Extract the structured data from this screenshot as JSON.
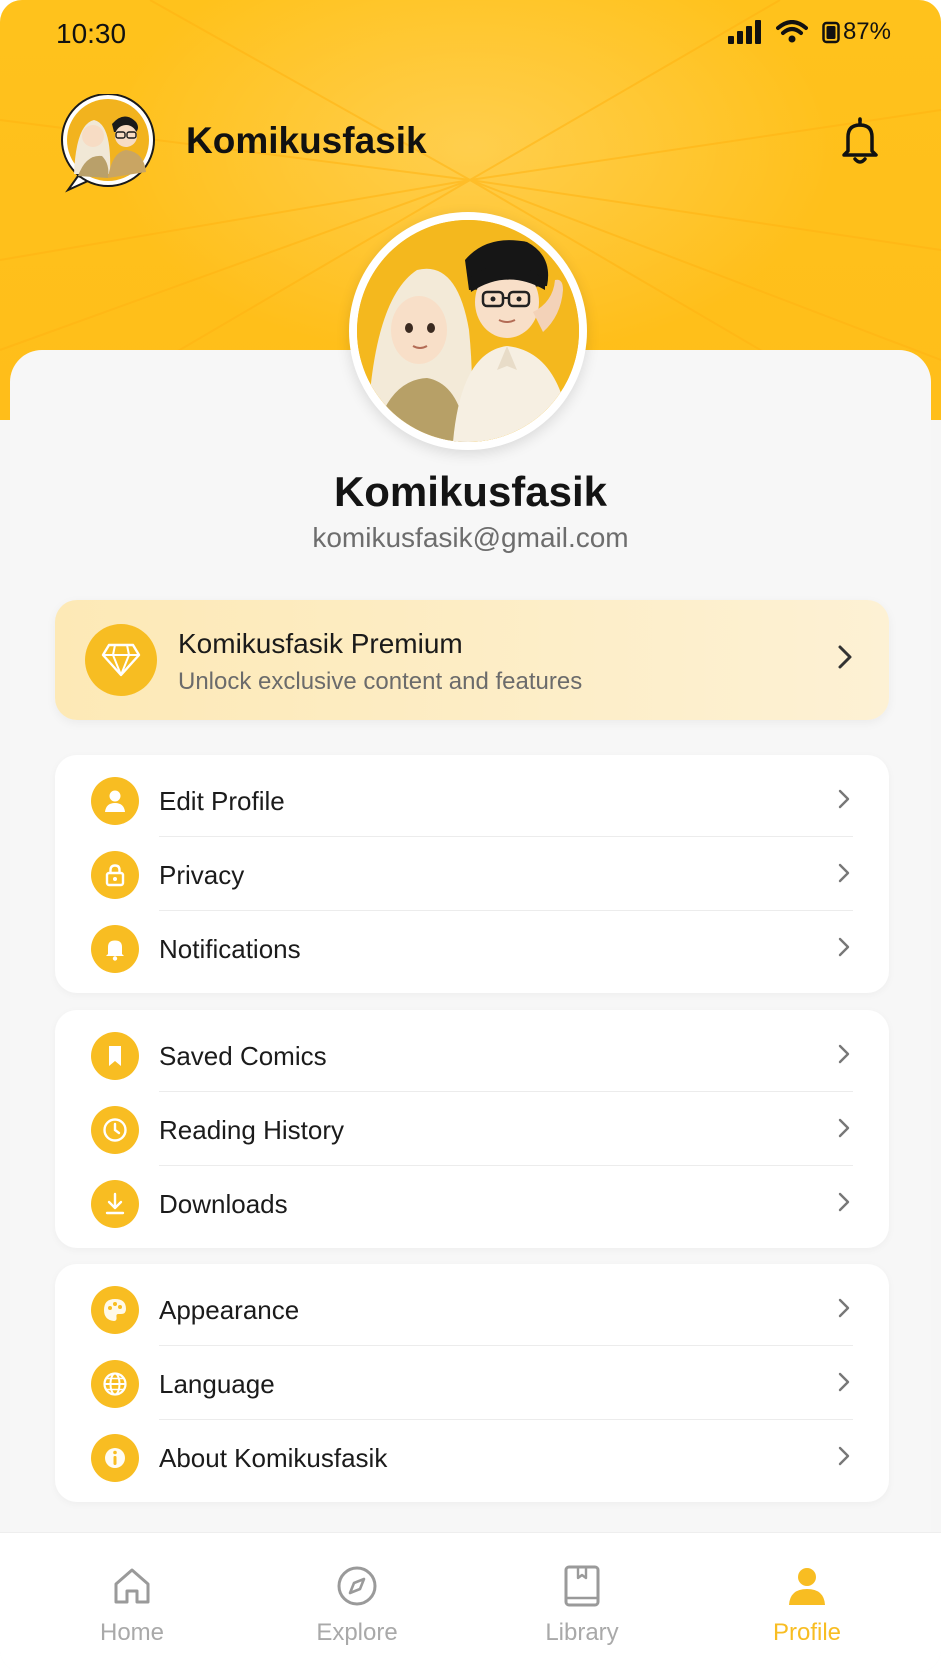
{
  "status_bar": {
    "time": "10:30",
    "battery": "87%"
  },
  "app_bar": {
    "title": "Komikusfasik"
  },
  "profile": {
    "name": "Komikusfasik",
    "email": "komikusfasik@gmail.com"
  },
  "premium": {
    "title": "Komikusfasik Premium",
    "subtitle": "Unlock exclusive content and features"
  },
  "sections": {
    "account": [
      {
        "label": "Edit Profile",
        "icon": "user-icon"
      },
      {
        "label": "Privacy",
        "icon": "lock-icon"
      },
      {
        "label": "Notifications",
        "icon": "bell-icon"
      }
    ],
    "library": [
      {
        "label": "Saved Comics",
        "icon": "bookmark-icon"
      },
      {
        "label": "Reading History",
        "icon": "clock-icon"
      },
      {
        "label": "Downloads",
        "icon": "download-icon"
      }
    ],
    "app": [
      {
        "label": "Appearance",
        "icon": "palette-icon"
      },
      {
        "label": "Language",
        "icon": "globe-icon"
      },
      {
        "label": "About Komikusfasik",
        "icon": "info-icon"
      }
    ]
  },
  "bottom_nav": [
    {
      "label": "Home",
      "icon": "home-icon"
    },
    {
      "label": "Explore",
      "icon": "compass-icon"
    },
    {
      "label": "Library",
      "icon": "book-icon"
    },
    {
      "label": "Profile",
      "icon": "profile-icon",
      "active": true
    }
  ],
  "colors": {
    "accent": "#f8bd22",
    "header": "#ffc21c",
    "premium_bg": "#fdebb9"
  }
}
